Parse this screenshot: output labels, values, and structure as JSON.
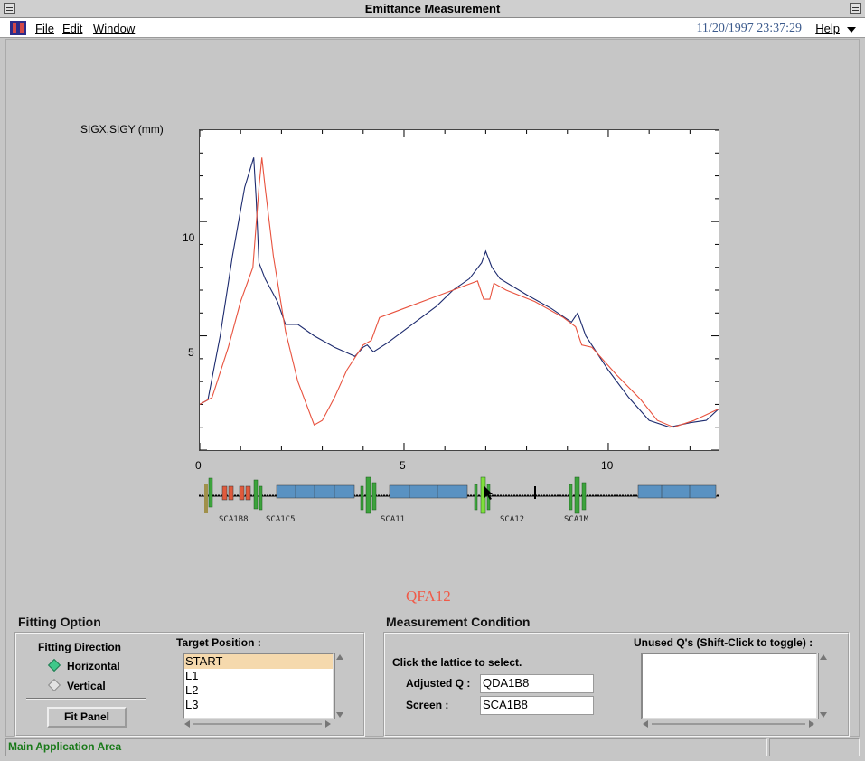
{
  "window": {
    "title": "Emittance Measurement"
  },
  "menu": {
    "file": "File",
    "edit": "Edit",
    "window": "Window",
    "help": "Help",
    "datetime": "11/20/1997 23:37:29"
  },
  "plot": {
    "ylabel": "SIGX,SIGY (mm)",
    "yticks": [
      "10",
      "5"
    ],
    "xticks": [
      "0",
      "5",
      "10"
    ]
  },
  "chart_data": {
    "type": "line",
    "ylabel": "SIGX,SIGY (mm)",
    "xlim": [
      0,
      12.7
    ],
    "ylim": [
      0,
      14
    ],
    "grid": false,
    "series": [
      {
        "color": "#1c2a6e",
        "x": [
          0,
          0.2,
          0.5,
          0.8,
          1.1,
          1.32,
          1.38,
          1.45,
          1.6,
          1.9,
          2.1,
          2.4,
          2.8,
          3.3,
          3.8,
          4.0,
          4.1,
          4.25,
          4.6,
          5.2,
          5.8,
          6.2,
          6.6,
          6.9,
          7.0,
          7.15,
          7.35,
          8.0,
          8.6,
          9.1,
          9.25,
          9.45,
          10.0,
          10.5,
          11.0,
          11.5,
          12.0,
          12.4,
          12.7
        ],
        "y": [
          2.0,
          2.2,
          5.0,
          8.5,
          11.5,
          12.8,
          11.0,
          8.2,
          7.5,
          6.5,
          5.5,
          5.5,
          5.0,
          4.5,
          4.1,
          4.5,
          4.6,
          4.3,
          4.7,
          5.5,
          6.3,
          7.0,
          7.5,
          8.2,
          8.7,
          8.0,
          7.5,
          6.8,
          6.2,
          5.6,
          6.0,
          5.0,
          3.5,
          2.3,
          1.3,
          1.0,
          1.2,
          1.3,
          1.8
        ]
      },
      {
        "color": "#e8523e",
        "x": [
          0,
          0.3,
          0.7,
          1.0,
          1.3,
          1.45,
          1.52,
          1.6,
          1.8,
          2.1,
          2.4,
          2.8,
          3.0,
          3.3,
          3.6,
          4.0,
          4.2,
          4.4,
          4.7,
          5.3,
          5.6,
          6.2,
          6.8,
          6.95,
          7.1,
          7.2,
          7.5,
          8.2,
          8.9,
          9.2,
          9.35,
          9.6,
          10.2,
          10.8,
          11.2,
          11.6,
          12.1,
          12.7
        ],
        "y": [
          2.0,
          2.3,
          4.5,
          6.5,
          8.0,
          11.5,
          12.8,
          11.5,
          8.5,
          5.2,
          3.0,
          1.1,
          1.3,
          2.3,
          3.5,
          4.6,
          4.8,
          5.8,
          6.0,
          6.4,
          6.6,
          7.0,
          7.4,
          6.6,
          6.6,
          7.3,
          7.0,
          6.5,
          5.8,
          5.4,
          4.6,
          4.5,
          3.3,
          2.2,
          1.3,
          1.0,
          1.3,
          1.8
        ]
      }
    ]
  },
  "lattice": {
    "labels": [
      "SCA1B8",
      "SCA1C5",
      "SCA11",
      "SCA12",
      "SCA1M"
    ],
    "instruction": "Click the lattice to select."
  },
  "selected_element": "QFA12",
  "fitting": {
    "title": "Fitting Option",
    "direction_label": "Fitting Direction",
    "horizontal": "Horizontal",
    "vertical": "Vertical",
    "fit_panel": "Fit Panel",
    "target_label": "Target Position :",
    "targets": [
      "START",
      "L1",
      "L2",
      "L3"
    ]
  },
  "measurement": {
    "title": "Measurement Condition",
    "instruction": "Click the lattice to select.",
    "adjusted_q_label": "Adjusted Q :",
    "adjusted_q_value": "QDA1B8",
    "screen_label": "Screen :",
    "screen_value": "SCA1B8",
    "unused_label": "Unused Q's (Shift-Click to toggle) :"
  },
  "status": {
    "text": "Main Application Area"
  }
}
